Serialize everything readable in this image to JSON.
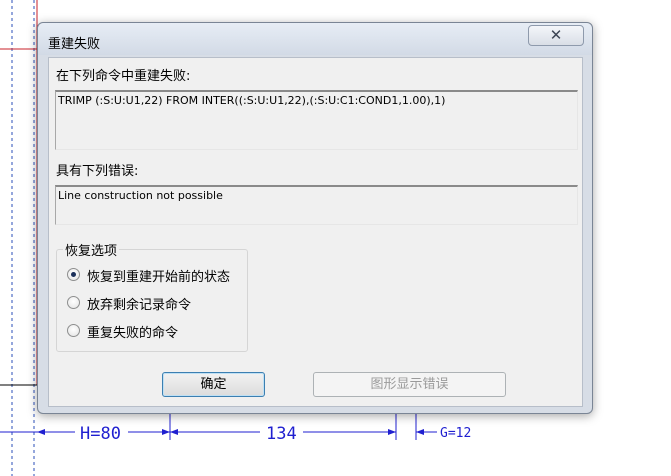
{
  "dialog": {
    "title": "重建失败",
    "close_glyph": "✕",
    "failed_label": "在下列命令中重建失败:",
    "command_text": "TRIMP (:S:U:U1,22) FROM INTER((:S:U:U1,22),(:S:U:C1:COND1,1.00),1)",
    "error_label": "具有下列错误:",
    "error_text": "Line construction not possible",
    "recovery": {
      "title": "恢复选项",
      "options": [
        {
          "label": "恢复到重建开始前的状态",
          "selected": true
        },
        {
          "label": "放弃剩余记录命令",
          "selected": false
        },
        {
          "label": "重复失败的命令",
          "selected": false
        }
      ]
    },
    "ok_label": "确定",
    "show_error_label": "图形显示错误"
  },
  "cad": {
    "dim_h": "H=80",
    "dim_134": "134",
    "dim_g": "G=12"
  }
}
